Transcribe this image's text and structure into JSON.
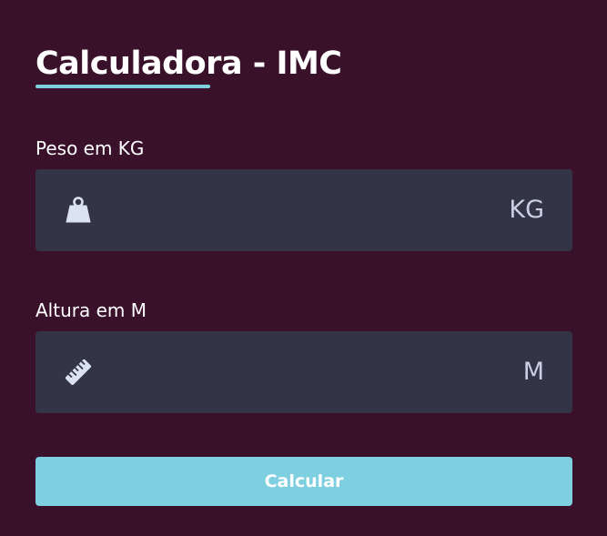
{
  "header": {
    "title": "Calculadora - IMC"
  },
  "weight": {
    "label": "Peso em KG",
    "value": "",
    "placeholder": "",
    "unit": "KG",
    "icon": "weight-icon"
  },
  "height": {
    "label": "Altura em M",
    "value": "",
    "placeholder": "",
    "unit": "M",
    "icon": "ruler-icon"
  },
  "actions": {
    "calculate_label": "Calcular"
  },
  "colors": {
    "background": "#3a112b",
    "field_background": "#343447",
    "accent": "#7ecfe0",
    "unit_text": "#c9d0e3"
  }
}
